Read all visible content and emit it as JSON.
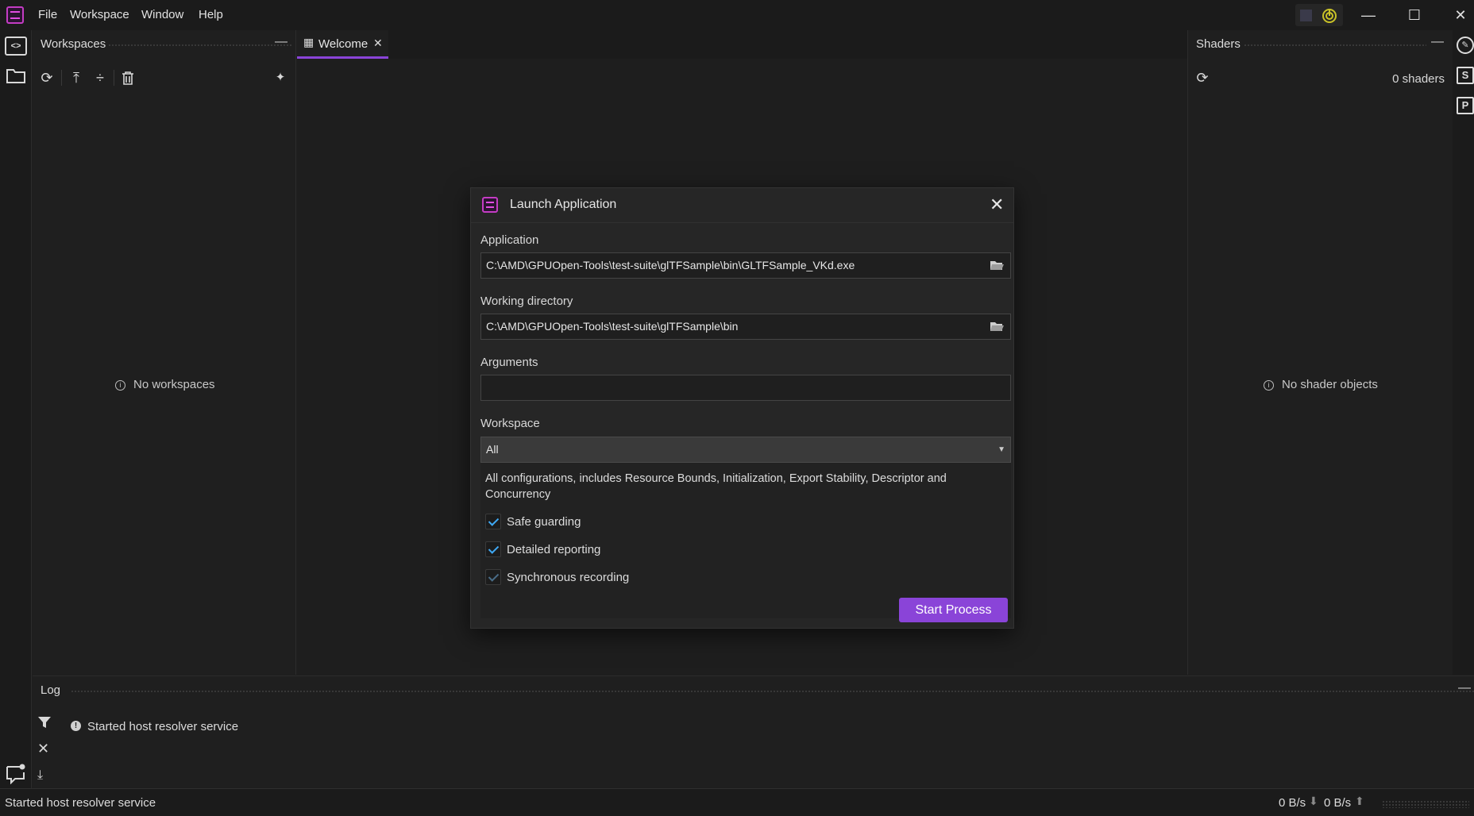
{
  "menu": [
    "File",
    "Workspace",
    "Window",
    "Help"
  ],
  "workspaces_panel": {
    "title": "Workspaces",
    "empty": "No workspaces"
  },
  "tabs": [
    {
      "label": "Welcome"
    }
  ],
  "shaders_panel": {
    "title": "Shaders",
    "count": "0 shaders",
    "empty": "No shader objects"
  },
  "dialog": {
    "title": "Launch Application",
    "application_label": "Application",
    "application_value": "C:\\AMD\\GPUOpen-Tools\\test-suite\\glTFSample\\bin\\GLTFSample_VKd.exe",
    "workdir_label": "Working directory",
    "workdir_value": "C:\\AMD\\GPUOpen-Tools\\test-suite\\glTFSample\\bin",
    "arguments_label": "Arguments",
    "arguments_value": "",
    "workspace_label": "Workspace",
    "workspace_selected": "All",
    "workspace_desc": "All configurations, includes Resource Bounds, Initialization, Export Stability, Descriptor and Concurrency",
    "options": [
      {
        "label": "Safe guarding",
        "checked": true
      },
      {
        "label": "Detailed reporting",
        "checked": true
      },
      {
        "label": "Synchronous recording",
        "checked": true
      }
    ],
    "start_button": "Start Process"
  },
  "log": {
    "title": "Log",
    "entries": [
      "Started host resolver service"
    ]
  },
  "status": {
    "message": "Started host resolver service",
    "download": "0 B/s",
    "upload": "0 B/s"
  },
  "colors": {
    "accent": "#8a44d8",
    "check": "#3fa9f5",
    "tab_underline": "#8a44d8"
  }
}
